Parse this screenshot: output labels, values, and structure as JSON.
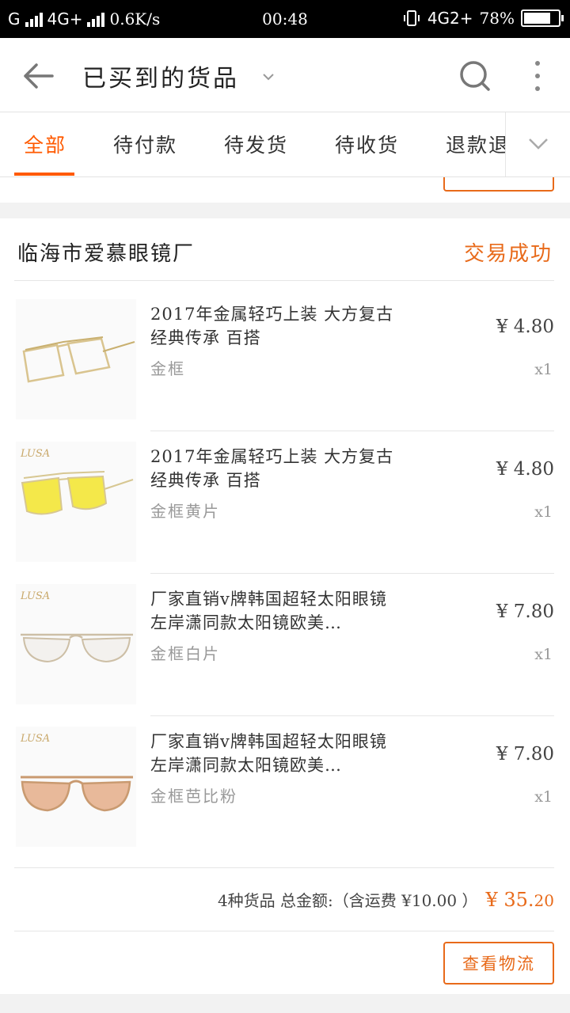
{
  "status_bar": {
    "carrier": "G",
    "network": "4G+",
    "speed": "0.6K/s",
    "time": "00:48",
    "network_right": "4G2+",
    "battery": "78%",
    "battery_level": 0.78
  },
  "header": {
    "title": "已买到的货品",
    "icons": [
      "back-arrow-icon",
      "chevron-down-icon",
      "search-icon",
      "more-vertical-icon"
    ]
  },
  "tabs": {
    "items": [
      "全部",
      "待付款",
      "待发货",
      "待收货",
      "退款退"
    ],
    "active_index": 0,
    "expand_icon": "chevron-down-icon"
  },
  "colors": {
    "accent": "#ff5a00",
    "status": "#e86a1a",
    "muted_text": "#999999"
  },
  "order": {
    "shop_name": "临海市爱慕眼镜厂",
    "status": "交易成功",
    "items": [
      {
        "name": "2017年金属轻巧上装 大方复古 经典传承 百搭",
        "sku": "金框",
        "price": "¥ 4.80",
        "qty": "x1",
        "brand": ""
      },
      {
        "name": "2017年金属轻巧上装 大方复古 经典传承 百搭",
        "sku": "金框黄片",
        "price": "¥ 4.80",
        "qty": "x1",
        "brand": "LUSA"
      },
      {
        "name": "厂家直销v牌韩国超轻太阳眼镜左岸潇同款太阳镜欧美…",
        "sku": "金框白片",
        "price": "¥ 7.80",
        "qty": "x1",
        "brand": "LUSA"
      },
      {
        "name": "厂家直销v牌韩国超轻太阳眼镜左岸潇同款太阳镜欧美…",
        "sku": "金框芭比粉",
        "price": "¥ 7.80",
        "qty": "x1",
        "brand": "LUSA"
      }
    ],
    "summary_text": "4种货品 总金额:（含运费 ¥10.00 ）",
    "total_main": "¥ 35.",
    "total_cents": "20",
    "logistics_button": "查看物流"
  }
}
